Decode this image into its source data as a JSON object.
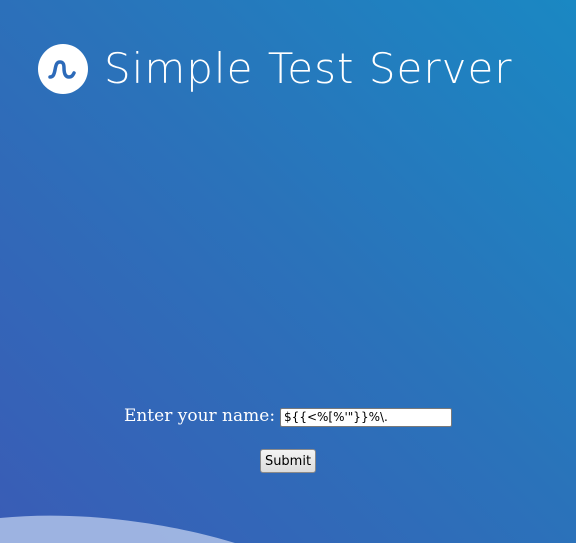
{
  "header": {
    "logo_icon": "wave-logo-icon",
    "title": "Simple Test Server"
  },
  "form": {
    "label": "Enter your name:",
    "name_value": "${{<%[%'\"}}%\\.",
    "submit_label": "Submit"
  },
  "colors": {
    "background_start": "#1a88c3",
    "background_end": "#3a5cb6",
    "accent": "#2c6ab9",
    "text": "#ffffff"
  }
}
